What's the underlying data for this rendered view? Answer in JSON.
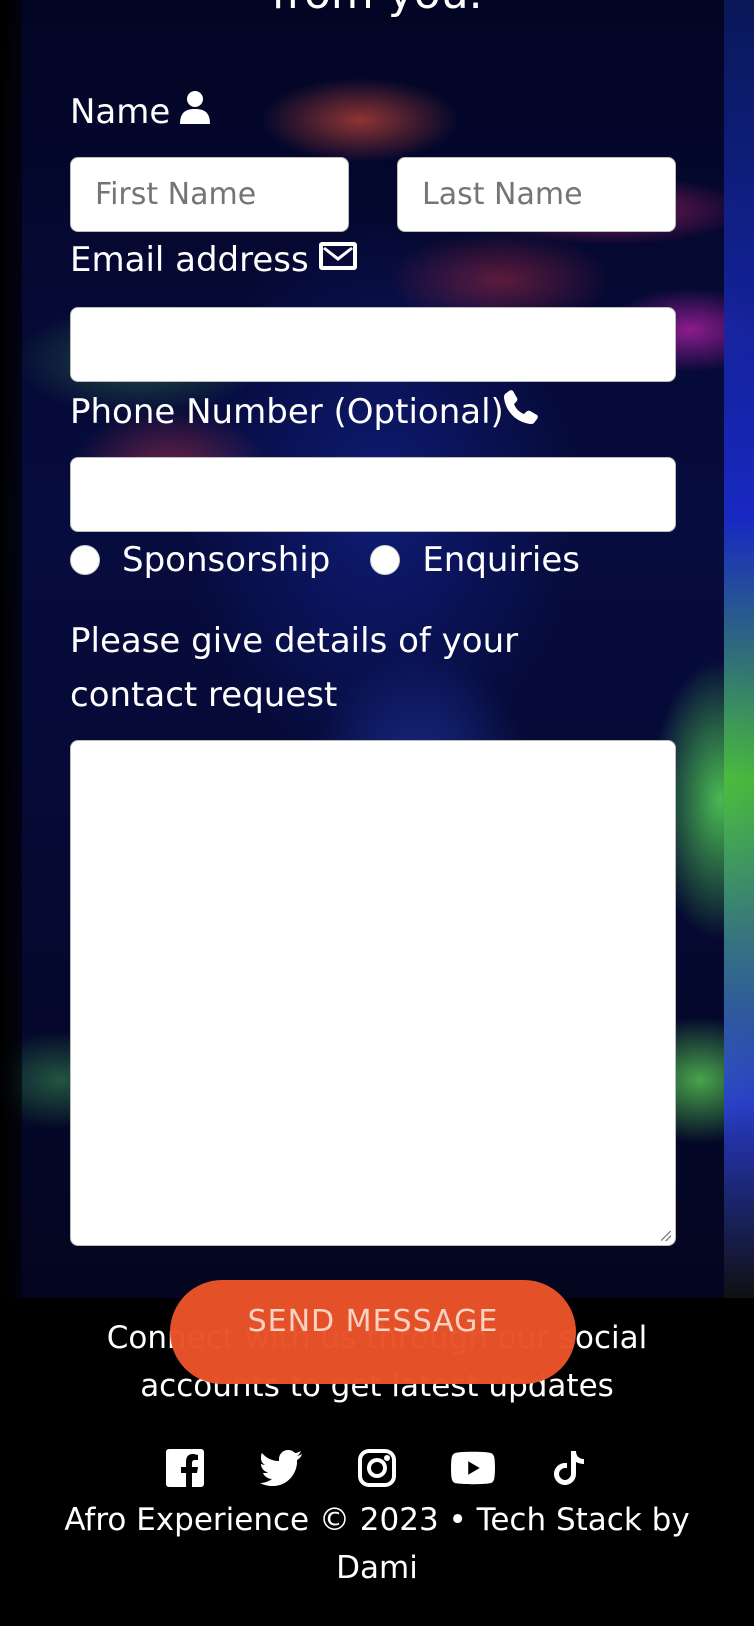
{
  "header": {
    "partial_heading": "from you."
  },
  "form": {
    "name_label": "Name",
    "first_name_placeholder": "First Name",
    "last_name_placeholder": "Last Name",
    "email_label": "Email address",
    "phone_label": "Phone Number (Optional)",
    "radio_options": [
      "Sponsorship",
      "Enquiries"
    ],
    "details_label": "Please give details of your contact request",
    "send_label": "SEND MESSAGE"
  },
  "icons": {
    "name": "user-icon",
    "email": "envelope-icon",
    "phone": "phone-icon",
    "social": [
      "facebook-icon",
      "twitter-icon",
      "instagram-icon",
      "youtube-icon",
      "tiktok-icon"
    ]
  },
  "footer": {
    "connect_text": "Connect with us through our social accounts to get latest updates",
    "copyright": "Afro Experience © 2023 • Tech Stack by Dami"
  },
  "colors": {
    "send_button": "#e9532a",
    "background": "#070c3f",
    "footer": "#000000"
  }
}
